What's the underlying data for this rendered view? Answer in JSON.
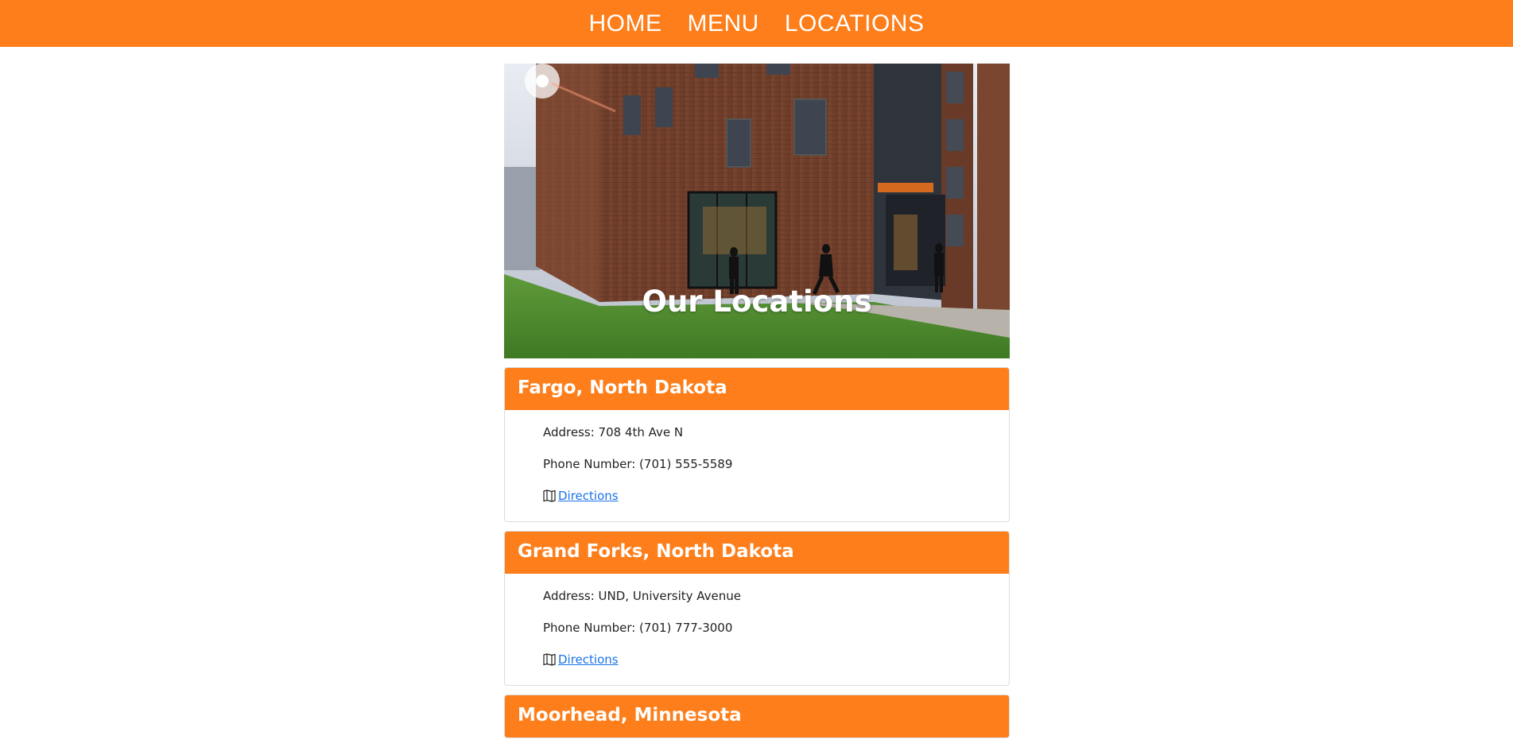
{
  "nav": {
    "items": [
      {
        "label": "HOME"
      },
      {
        "label": "MENU"
      },
      {
        "label": "LOCATIONS"
      }
    ]
  },
  "hero": {
    "title": "Our Locations"
  },
  "locations": [
    {
      "name": "Fargo, North Dakota",
      "address": "Address: 708 4th Ave N",
      "phone": "Phone Number: (701) 555-5589",
      "directions": "Directions"
    },
    {
      "name": "Grand Forks, North Dakota",
      "address": "Address: UND, University Avenue",
      "phone": "Phone Number: (701) 777-3000",
      "directions": "Directions"
    },
    {
      "name": "Moorhead, Minnesota"
    }
  ],
  "colors": {
    "brand": "#fd7e1a",
    "link": "#1a73e8"
  },
  "icons": {
    "directions": "map-icon"
  }
}
